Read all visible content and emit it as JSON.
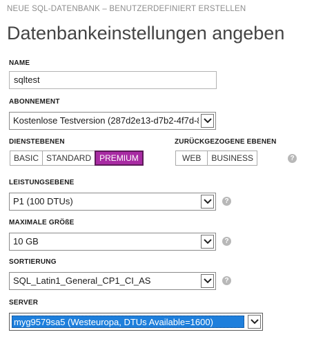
{
  "header": {
    "wizard_title": "NEUE SQL-DATENBANK – BENUTZERDEFINIERT ERSTELLEN",
    "page_title": "Datenbankeinstellungen angeben"
  },
  "name": {
    "label": "NAME",
    "value": "sqltest"
  },
  "subscription": {
    "label": "ABONNEMENT",
    "value": "Kostenlose Testversion (287d2e13-d7b2-4f7d-8"
  },
  "service_tiers": {
    "label": "DIENSTEBENEN",
    "options": [
      "BASIC",
      "STANDARD",
      "PREMIUM"
    ],
    "selected": "PREMIUM"
  },
  "retired_tiers": {
    "label": "ZURÜCKGEZOGENE EBENEN",
    "options": [
      "WEB",
      "BUSINESS"
    ]
  },
  "performance_level": {
    "label": "LEISTUNGSEBENE",
    "value": "P1 (100 DTUs)"
  },
  "max_size": {
    "label": "MAXIMALE GRÖßE",
    "value": "10 GB"
  },
  "collation": {
    "label": "SORTIERUNG",
    "value": "SQL_Latin1_General_CP1_CI_AS"
  },
  "server": {
    "label": "SERVER",
    "value": "myg9579sa5 (Westeuropa, DTUs Available=1600)"
  },
  "help_glyph": "?",
  "colors": {
    "accent_selected": "#a82ba3",
    "selection_blue": "#1e7fdc",
    "help_icon": "#b8b8b8"
  }
}
